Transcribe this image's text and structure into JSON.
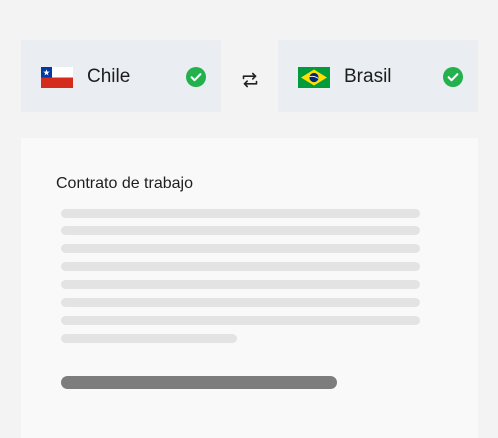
{
  "translation": {
    "from": {
      "country": "Chile",
      "flag_icon": "chile-flag-icon",
      "verified_icon": "check-circle-icon"
    },
    "to": {
      "country": "Brasil",
      "flag_icon": "brazil-flag-icon",
      "verified_icon": "check-circle-icon"
    },
    "swap_icon": "swap-arrows-icon"
  },
  "document": {
    "title": "Contrato de trabajo",
    "placeholder_line_count": 8
  },
  "colors": {
    "background": "#f3f3f3",
    "card_background": "#eaedf1",
    "document_background": "#f9f9f9",
    "check_green": "#22b14c",
    "placeholder_line": "#e3e3e3",
    "action_bar": "#7d7d7d"
  }
}
